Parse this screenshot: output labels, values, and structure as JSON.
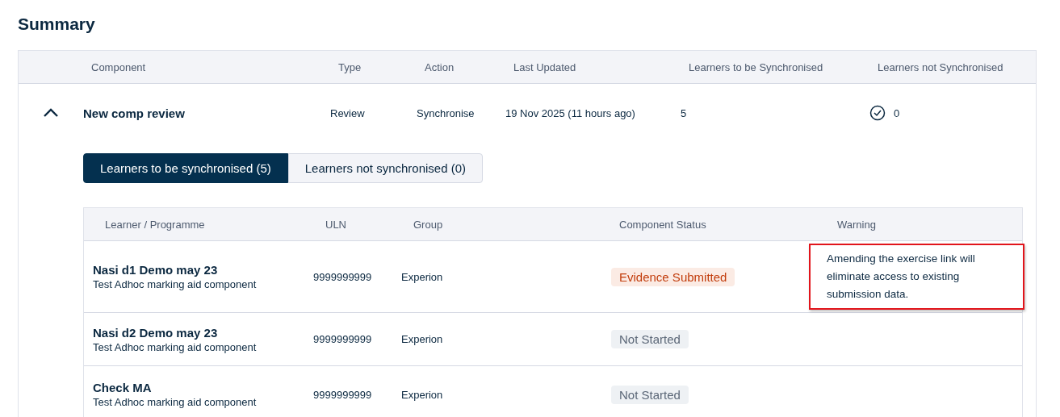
{
  "title": "Summary",
  "table": {
    "columns": [
      "Component",
      "Type",
      "Action",
      "Last Updated",
      "Learners to be Synchronised",
      "Learners not Synchronised"
    ],
    "rows": [
      {
        "expanded": true,
        "component": "New comp review",
        "type": "Review",
        "action": "Synchronise",
        "last_updated": "19 Nov 2025 (11 hours ago)",
        "to_sync": "5",
        "not_synced": "0",
        "tabs": [
          {
            "label": "Learners to be synchronised (5)",
            "selected": true
          },
          {
            "label": "Learners not synchronised (0)",
            "selected": false
          }
        ],
        "learners": {
          "columns": [
            "Learner / Programme",
            "ULN",
            "Group",
            "Component Status",
            "Warning"
          ],
          "rows": [
            {
              "name": "Nasi d1 Demo may 23",
              "programme": "Test Adhoc marking aid component",
              "uln": "9999999999",
              "group": "Experion",
              "status": "Evidence Submitted",
              "kind": "submitted",
              "warning": "Amending the exercise link will eliminate access to existing submission data."
            },
            {
              "name": "Nasi d2 Demo may 23",
              "programme": "Test Adhoc marking aid component",
              "uln": "9999999999",
              "group": "Experion",
              "status": "Not Started",
              "kind": "not_started"
            },
            {
              "name": "Check MA",
              "programme": "Test Adhoc marking aid component",
              "uln": "9999999999",
              "group": "Experion",
              "status": "Not Started",
              "kind": "not_started"
            }
          ]
        }
      }
    ]
  }
}
